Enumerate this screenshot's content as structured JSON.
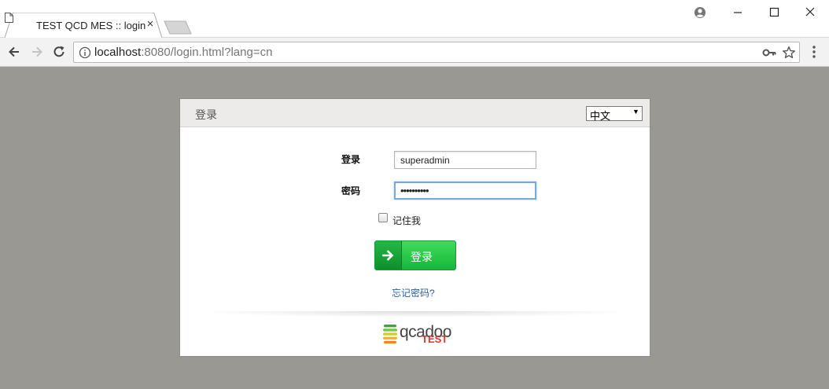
{
  "browser": {
    "tab_title": "TEST QCD MES :: login",
    "tab_close": "×",
    "url_host": "localhost",
    "url_rest": ":8080/login.html?lang=cn"
  },
  "login": {
    "panel_title": "登录",
    "language_selected": "中文",
    "language_arrow": "▼",
    "username_label": "登录",
    "username_value": "superadmin",
    "password_label": "密码",
    "password_masked": "••••••••••",
    "remember_label": "记住我",
    "remember_checked": false,
    "submit_label": "登录",
    "forgot_link": "忘记密码?"
  },
  "logo": {
    "brand": "qcadoo",
    "badge": "TEST"
  },
  "colors": {
    "page_background": "#999892",
    "button_green": "#17b53a",
    "link_blue": "#2c5f9e",
    "badge_red": "#e0322b"
  }
}
